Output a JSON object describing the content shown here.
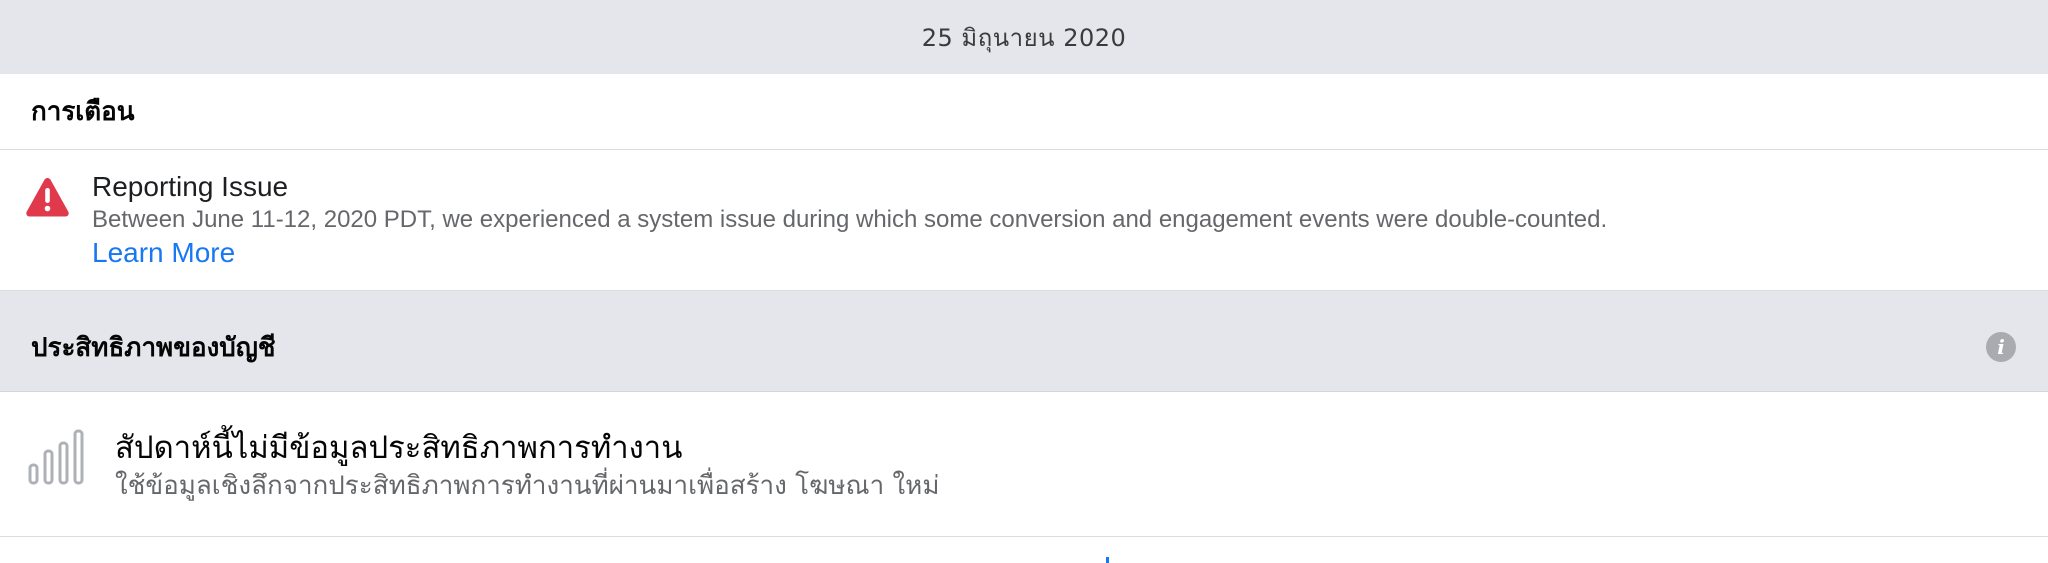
{
  "date_bar": {
    "text": "25 มิถุนายน 2020"
  },
  "notifications": {
    "header": "การเตือน",
    "alert": {
      "icon": "warning-triangle-icon",
      "title": "Reporting Issue",
      "description": "Between June 11-12, 2020 PDT, we experienced a system issue during which some conversion and engagement events were double-counted.",
      "link_label": "Learn More"
    }
  },
  "account_performance": {
    "header": "ประสิทธิภาพของบัญชี",
    "info_icon": "info-icon",
    "empty_state": {
      "icon": "bar-chart-icon",
      "title": "สัปดาห์นี้ไม่มีข้อมูลประสิทธิภาพการทำงาน",
      "subtitle": "ใช้ข้อมูลเชิงลึกจากประสิทธิภาพการทำงานที่ผ่านมาเพื่อสร้าง โฆษณา ใหม่"
    }
  },
  "colors": {
    "band_gray": "#e4e6eb",
    "link_blue": "#1877f2",
    "warning_red": "#e0394c",
    "muted_text": "#65676b"
  }
}
